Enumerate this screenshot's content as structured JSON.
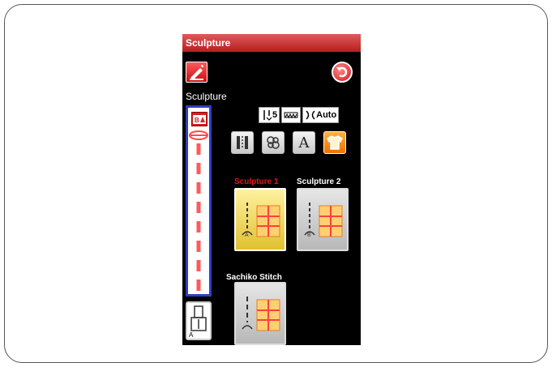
{
  "screen": {
    "title": "Sculpture",
    "heading": "Sculpture",
    "colors": {
      "title_bar": "#c02828",
      "selected_label": "#e01a1a",
      "preview_border": "#2f3fc0",
      "active_mode": "#f07000"
    },
    "indicators": {
      "stitch_length_value": "5",
      "tension_value": "Auto"
    },
    "mode_buttons": [
      {
        "icon": "utility-stitch-icon",
        "active": false
      },
      {
        "icon": "decorative-stitch-icon",
        "active": false
      },
      {
        "icon": "letter-a-icon",
        "label": "A",
        "active": false
      },
      {
        "icon": "shirt-icon",
        "active": true
      }
    ],
    "patterns": [
      {
        "label": "Sculpture 1",
        "selected": true
      },
      {
        "label": "Sculpture 2",
        "selected": false
      },
      {
        "label": "Sachiko Stitch",
        "selected": false
      }
    ],
    "foot_label": "A"
  }
}
